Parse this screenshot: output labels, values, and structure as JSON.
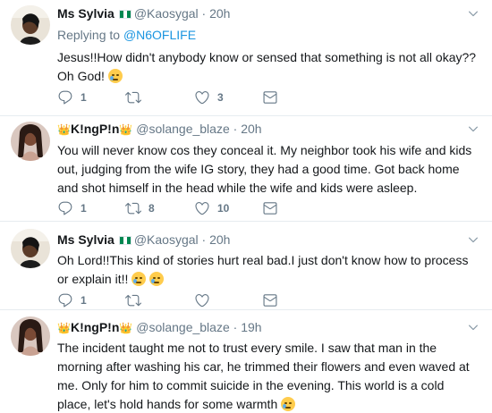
{
  "tweets": [
    {
      "name": "Ms Sylvia",
      "handle": "@Kaosygal",
      "dot": "·",
      "time": "20h",
      "replying_prefix": "Replying to",
      "replying_to": "@N6OFLIFE",
      "text": "Jesus!!How didn't anybody know or sensed that something is not all okay??Oh God!",
      "reply_count": "1",
      "retweet_count": "",
      "like_count": "3"
    },
    {
      "name": "K!ngP!n",
      "handle": "@solange_blaze",
      "dot": "·",
      "time": "20h",
      "text": "You will never know cos they conceal it. My neighbor took his wife and kids out, judging from the wife IG story, they had a good time. Got back home and shot himself in the head while the wife and kids were asleep.",
      "reply_count": "1",
      "retweet_count": "8",
      "like_count": "10"
    },
    {
      "name": "Ms Sylvia",
      "handle": "@Kaosygal",
      "dot": "·",
      "time": "20h",
      "text": "Oh Lord!!This kind of stories hurt real bad.I just don't know how to process or explain it!!",
      "reply_count": "1",
      "retweet_count": "",
      "like_count": ""
    },
    {
      "name": "K!ngP!n",
      "handle": "@solange_blaze",
      "dot": "·",
      "time": "19h",
      "text": "The incident taught me not to trust every smile. I saw that man in the morning after washing his car, he trimmed their flowers and even waved at me. Only for him to commit suicide in the evening. This world is a cold place, let's hold hands for some warmth",
      "reply_count": "",
      "retweet_count": "",
      "like_count": ""
    }
  ],
  "icons": {
    "reply": "reply-icon",
    "retweet": "retweet-icon",
    "like": "heart-icon",
    "dm": "direct-message-icon",
    "caret": "chevron-down-icon",
    "flag": "nigeria-flag-icon",
    "crown": "crown-emoji-icon",
    "crying": "crying-face-emoji-icon",
    "anxious": "anxious-face-emoji-icon"
  },
  "colors": {
    "link": "#1b95e0",
    "muted": "#657786",
    "separator": "#e6ecf0"
  }
}
